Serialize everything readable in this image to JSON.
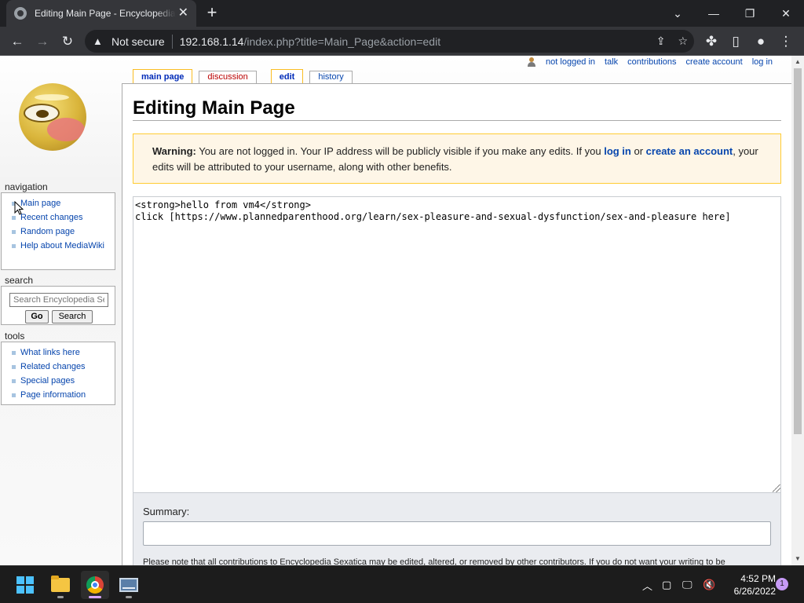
{
  "browser": {
    "tab_title": "Editing Main Page - Encyclopedia Sexatica",
    "url_security": "Not secure",
    "url_host": "192.168.1.14",
    "url_path": "/index.php?title=Main_Page&action=edit"
  },
  "personal": [
    {
      "label": "not logged in",
      "name": "personal-not-logged-in"
    },
    {
      "label": "talk",
      "name": "personal-talk"
    },
    {
      "label": "contributions",
      "name": "personal-contributions"
    },
    {
      "label": "create account",
      "name": "personal-create-account"
    },
    {
      "label": "log in",
      "name": "personal-log-in"
    }
  ],
  "tabs": {
    "main_page": "main page",
    "discussion": "discussion",
    "edit": "edit",
    "history": "history"
  },
  "sidebar": {
    "navigation_heading": "navigation",
    "navigation": [
      "Main page",
      "Recent changes",
      "Random page",
      "Help about MediaWiki"
    ],
    "search_heading": "search",
    "search_placeholder": "Search Encyclopedia Sexatica",
    "go_label": "Go",
    "search_label": "Search",
    "tools_heading": "tools",
    "tools": [
      "What links here",
      "Related changes",
      "Special pages",
      "Page information"
    ]
  },
  "content": {
    "heading": "Editing Main Page",
    "warning_bold": "Warning:",
    "warning_text_1": " You are not logged in. Your IP address will be publicly visible if you make any edits. If you ",
    "warning_login": "log in",
    "warning_text_2": " or ",
    "warning_create": "create an account",
    "warning_text_3": ", your edits will be attributed to your username, along with other benefits.",
    "editor_lines": [
      "<strong>hello from vm4</strong>",
      "",
      "click [https://www.plannedparenthood.org/learn/sex-pleasure-and-sexual-dysfunction/sex-and-pleasure here]"
    ],
    "summary_label": "Summary:",
    "notice": "Please note that all contributions to Encyclopedia Sexatica may be edited, altered, or removed by other contributors. If you do not want your writing to be"
  },
  "taskbar": {
    "time": "4:52 PM",
    "date": "6/26/2022",
    "notification_count": "1"
  },
  "colors": {
    "link": "#0645ad",
    "warning_bg": "#fef6e7",
    "warning_border": "#ffcc33",
    "selected_tab_border": "#fabd23"
  }
}
